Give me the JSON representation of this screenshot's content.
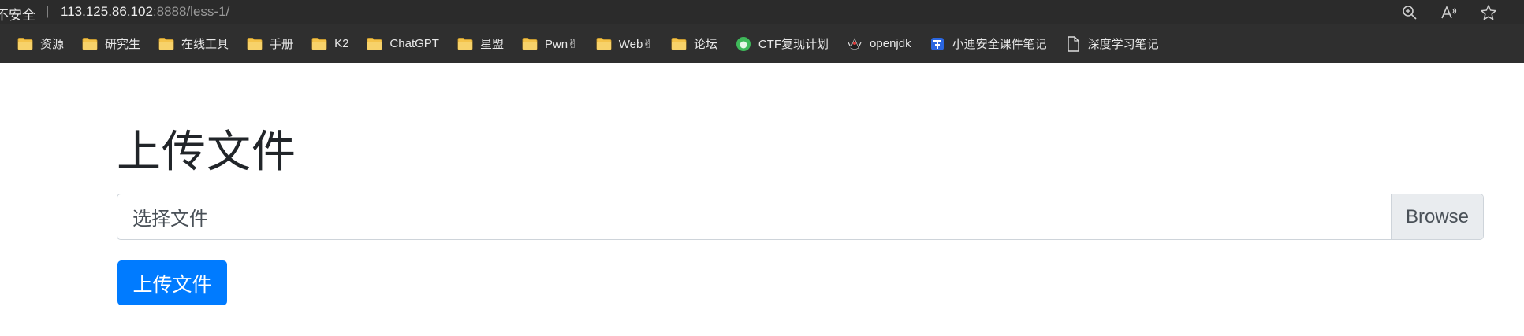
{
  "browser": {
    "security_text": "不安全",
    "separator": "|",
    "url_host": "113.125.86.102",
    "url_rest": ":8888/less-1/",
    "tools": [
      "zoom-icon",
      "read-aloud-icon",
      "favorite-star-icon"
    ]
  },
  "bookmarks": [
    {
      "label": "资源",
      "icon": "folder-icon"
    },
    {
      "label": "研究生",
      "icon": "folder-icon"
    },
    {
      "label": "在线工具",
      "icon": "folder-icon"
    },
    {
      "label": "手册",
      "icon": "folder-icon"
    },
    {
      "label": "K2",
      "icon": "folder-icon"
    },
    {
      "label": "ChatGPT",
      "icon": "folder-icon"
    },
    {
      "label": "星盟",
      "icon": "folder-icon"
    },
    {
      "label": "Pwn✌",
      "icon": "folder-icon"
    },
    {
      "label": "Web✌",
      "icon": "folder-icon"
    },
    {
      "label": "论坛",
      "icon": "folder-icon"
    },
    {
      "label": "CTF复现计划",
      "icon": "green-circle-icon"
    },
    {
      "label": "openjdk",
      "icon": "java-duke-icon"
    },
    {
      "label": "小迪安全课件笔记",
      "icon": "blue-t-icon"
    },
    {
      "label": "深度学习笔记",
      "icon": "document-icon"
    }
  ],
  "page": {
    "heading": "上传文件",
    "file_label": "选择文件",
    "browse_label": "Browse",
    "submit_label": "上传文件"
  },
  "colors": {
    "primary": "#007bff",
    "folder": "#f4c34a"
  }
}
